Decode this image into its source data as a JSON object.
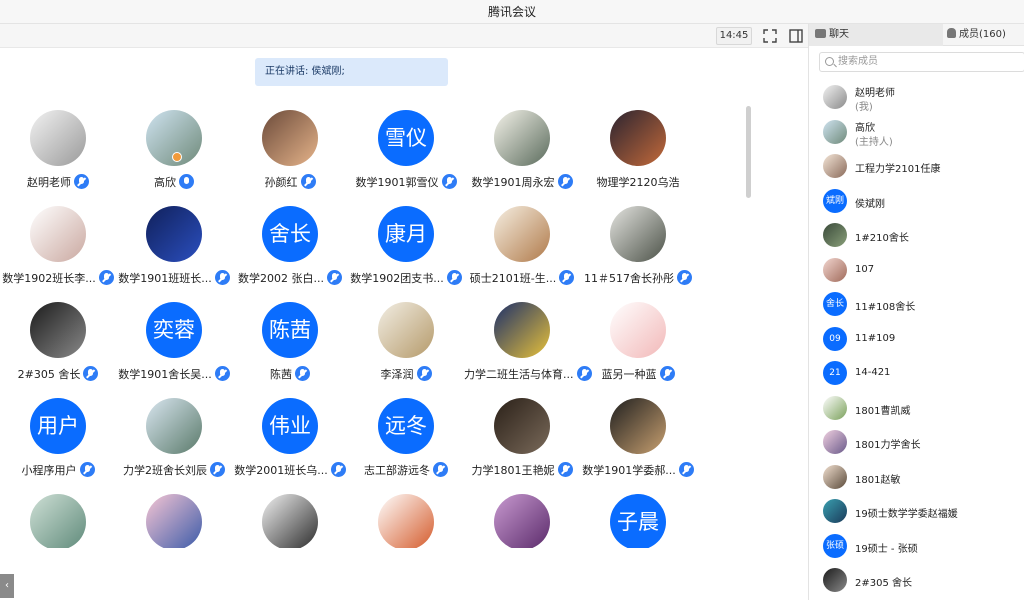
{
  "window": {
    "title": "腾讯会议"
  },
  "toolbar": {
    "time": "14:45"
  },
  "speaking": {
    "text": "正在讲话: 侯斌刚;"
  },
  "participants": [
    {
      "name": "赵明老师",
      "avatar_text": "",
      "c1": "#f2f2f2",
      "c2": "#9a9a9a",
      "mic": "muted"
    },
    {
      "name": "高欣",
      "avatar_text": "",
      "c1": "#cfe3f0",
      "c2": "#6f8a7a",
      "mic": "active",
      "host": true
    },
    {
      "name": "孙颜红",
      "avatar_text": "",
      "c1": "#6b4a3a",
      "c2": "#e6b48a",
      "mic": "muted"
    },
    {
      "name": "数学1901郭雪仪",
      "avatar_text": "雪仪",
      "mic": "muted"
    },
    {
      "name": "数学1901周永宏",
      "avatar_text": "",
      "c1": "#f5f3ea",
      "c2": "#5a6b5c",
      "mic": "muted"
    },
    {
      "name": "物理学2120乌浩",
      "avatar_text": "",
      "c1": "#2a2330",
      "c2": "#c46a3a",
      "mic": "none"
    },
    {
      "name": "数学1902班长李...",
      "avatar_text": "",
      "c1": "#ffffff",
      "c2": "#caa8a0",
      "mic": "muted"
    },
    {
      "name": "数学1901班班长...",
      "avatar_text": "",
      "c1": "#10205a",
      "c2": "#2b4fbf",
      "mic": "muted"
    },
    {
      "name": "数学2002 张白...",
      "avatar_text": "舍长",
      "mic": "muted"
    },
    {
      "name": "数学1902团支书...",
      "avatar_text": "康月",
      "mic": "muted"
    },
    {
      "name": "硕士2101班-生...",
      "avatar_text": "",
      "c1": "#f6efe2",
      "c2": "#b07a4a",
      "mic": "muted"
    },
    {
      "name": "11＃517舍长孙彤",
      "avatar_text": "",
      "c1": "#e4e4e0",
      "c2": "#4c5248",
      "mic": "muted"
    },
    {
      "name": "2#305 舍长",
      "avatar_text": "",
      "c1": "#1b1b1b",
      "c2": "#8a8a8a",
      "mic": "muted"
    },
    {
      "name": "数学1901舍长吴...",
      "avatar_text": "奕蓉",
      "mic": "muted"
    },
    {
      "name": "陈茜",
      "avatar_text": "陈茜",
      "mic": "muted"
    },
    {
      "name": "李泽润",
      "avatar_text": "",
      "c1": "#f2eee4",
      "c2": "#b59a6a",
      "mic": "muted"
    },
    {
      "name": "力学二班生活与体育...",
      "avatar_text": "",
      "c1": "#1c2f6a",
      "c2": "#e8c23a",
      "mic": "muted"
    },
    {
      "name": "蓝另一种蓝",
      "avatar_text": "",
      "c1": "#ffffff",
      "c2": "#f2b8b8",
      "mic": "muted"
    },
    {
      "name": "小程序用户",
      "avatar_text": "用户",
      "mic": "muted"
    },
    {
      "name": "力学2班舍长刘辰",
      "avatar_text": "",
      "c1": "#d9e6f0",
      "c2": "#5a7a6a",
      "mic": "muted"
    },
    {
      "name": "数学2001班长乌...",
      "avatar_text": "伟业",
      "mic": "muted"
    },
    {
      "name": "志工部游远冬",
      "avatar_text": "远冬",
      "mic": "muted"
    },
    {
      "name": "力学1801王艳妮",
      "avatar_text": "",
      "c1": "#2a2018",
      "c2": "#7a6a5a",
      "mic": "muted"
    },
    {
      "name": "数学1901学委郝...",
      "avatar_text": "",
      "c1": "#1f1f1f",
      "c2": "#c8a070",
      "mic": "muted"
    },
    {
      "name": "",
      "avatar_text": "",
      "c1": "#cfe0d6",
      "c2": "#5f8a7a",
      "mic": "none"
    },
    {
      "name": "",
      "avatar_text": "",
      "c1": "#f7c6d4",
      "c2": "#3a5aa8",
      "mic": "none"
    },
    {
      "name": "",
      "avatar_text": "",
      "c1": "#f2f2f2",
      "c2": "#2a2a2a",
      "mic": "none"
    },
    {
      "name": "",
      "avatar_text": "",
      "c1": "#ffffff",
      "c2": "#d45a2a",
      "mic": "none"
    },
    {
      "name": "",
      "avatar_text": "",
      "c1": "#c89ad0",
      "c2": "#5a2a6a",
      "mic": "none"
    },
    {
      "name": "",
      "avatar_text": "子晨",
      "mic": "none"
    }
  ],
  "sidebar": {
    "tab_chat": "聊天",
    "tab_members": "成员(160)",
    "search_placeholder": "搜索成员",
    "members": [
      {
        "name": "赵明老师",
        "sub": "(我)",
        "avatar_text": "",
        "c1": "#f2f2f2",
        "c2": "#8a8a8a"
      },
      {
        "name": "高欣",
        "sub": "(主持人)",
        "avatar_text": "",
        "c1": "#cfe3f0",
        "c2": "#6f8a7a"
      },
      {
        "name": "工程力学2101任康",
        "sub": "",
        "avatar_text": "",
        "c1": "#f4e6d8",
        "c2": "#8a6a5a"
      },
      {
        "name": "侯斌刚",
        "sub": "",
        "avatar_text": "斌刚"
      },
      {
        "name": "1#210舍长",
        "sub": "",
        "avatar_text": "",
        "c1": "#3a4a3a",
        "c2": "#8aa07a"
      },
      {
        "name": "107",
        "sub": "",
        "avatar_text": "",
        "c1": "#f2d6d0",
        "c2": "#a06a5a"
      },
      {
        "name": "11#108舍长",
        "sub": "",
        "avatar_text": "舍长"
      },
      {
        "name": "11#109",
        "sub": "",
        "avatar_text": "09"
      },
      {
        "name": "14-421",
        "sub": "",
        "avatar_text": "21"
      },
      {
        "name": "1801曹凯威",
        "sub": "",
        "avatar_text": "",
        "c1": "#ffffff",
        "c2": "#7aa05a"
      },
      {
        "name": "1801力学舍长",
        "sub": "",
        "avatar_text": "",
        "c1": "#f0d0e0",
        "c2": "#6a5a8a"
      },
      {
        "name": "1801赵敏",
        "sub": "",
        "avatar_text": "",
        "c1": "#f2e0d0",
        "c2": "#5a4a3a"
      },
      {
        "name": "19硕士数学学委赵福媛",
        "sub": "",
        "avatar_text": "",
        "c1": "#3aa0b0",
        "c2": "#1a3a5a"
      },
      {
        "name": "19硕士 - 张硕",
        "sub": "",
        "avatar_text": "张硕"
      },
      {
        "name": "2#305 舍长",
        "sub": "",
        "avatar_text": "",
        "c1": "#1b1b1b",
        "c2": "#8a8a8a"
      }
    ]
  },
  "colors": {
    "accent": "#0a6cff",
    "mic": "#2e7cf6",
    "speaking_bg": "#dbe9fb"
  }
}
